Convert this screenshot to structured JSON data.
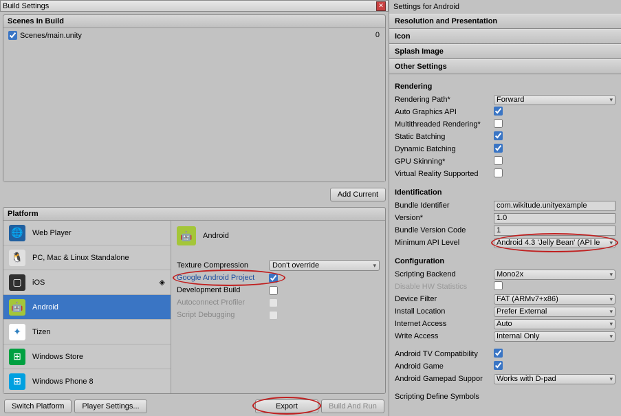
{
  "window": {
    "title": "Build Settings"
  },
  "scenes": {
    "header": "Scenes In Build",
    "items": [
      {
        "name": "Scenes/main.unity",
        "checked": true,
        "index": "0"
      }
    ],
    "add_current": "Add Current"
  },
  "platform": {
    "header": "Platform",
    "items": [
      {
        "name": "Web Player",
        "icon": "🌐",
        "bg": "#2060a0"
      },
      {
        "name": "PC, Mac & Linux Standalone",
        "icon": "🐧",
        "bg": "#e0e0e0"
      },
      {
        "name": "iOS",
        "icon": "📱",
        "bg": "#303030"
      },
      {
        "name": "Android",
        "icon": "🤖",
        "bg": "#a4c639",
        "selected": true
      },
      {
        "name": "Tizen",
        "icon": "✦",
        "bg": "#ffffff"
      },
      {
        "name": "Windows Store",
        "icon": "⊞",
        "bg": "#00a040"
      },
      {
        "name": "Windows Phone 8",
        "icon": "⊞",
        "bg": "#00a0e0"
      }
    ],
    "detail": {
      "title": "Android",
      "icon": "🤖",
      "texture_compression": {
        "label": "Texture Compression",
        "value": "Don't override"
      },
      "google_android": {
        "label": "Google Android Project",
        "checked": true
      },
      "dev_build": {
        "label": "Development Build",
        "checked": false
      },
      "autoconnect": {
        "label": "Autoconnect Profiler",
        "checked": false
      },
      "script_debug": {
        "label": "Script Debugging",
        "checked": false
      }
    }
  },
  "buttons": {
    "switch_platform": "Switch Platform",
    "player_settings": "Player Settings...",
    "export": "Export",
    "build_and_run": "Build And Run"
  },
  "right": {
    "title": "Settings for Android",
    "sections": {
      "resolution": "Resolution and Presentation",
      "icon": "Icon",
      "splash": "Splash Image",
      "other": "Other Settings"
    },
    "rendering": {
      "title": "Rendering",
      "path": {
        "label": "Rendering Path*",
        "value": "Forward"
      },
      "auto_gfx": {
        "label": "Auto Graphics API",
        "checked": true
      },
      "multithread": {
        "label": "Multithreaded Rendering*",
        "checked": false
      },
      "static_batch": {
        "label": "Static Batching",
        "checked": true
      },
      "dynamic_batch": {
        "label": "Dynamic Batching",
        "checked": true
      },
      "gpu_skin": {
        "label": "GPU Skinning*",
        "checked": false
      },
      "vr": {
        "label": "Virtual Reality Supported",
        "checked": false
      }
    },
    "identification": {
      "title": "Identification",
      "bundle": {
        "label": "Bundle Identifier",
        "value": "com.wikitude.unityexample"
      },
      "version": {
        "label": "Version*",
        "value": "1.0"
      },
      "version_code": {
        "label": "Bundle Version Code",
        "value": "1"
      },
      "min_api": {
        "label": "Minimum API Level",
        "value": "Android 4.3 'Jelly Bean' (API le"
      }
    },
    "configuration": {
      "title": "Configuration",
      "backend": {
        "label": "Scripting Backend",
        "value": "Mono2x"
      },
      "hw_stats": {
        "label": "Disable HW Statistics",
        "checked": false
      },
      "device_filter": {
        "label": "Device Filter",
        "value": "FAT (ARMv7+x86)"
      },
      "install_loc": {
        "label": "Install Location",
        "value": "Prefer External"
      },
      "internet": {
        "label": "Internet Access",
        "value": "Auto"
      },
      "write": {
        "label": "Write Access",
        "value": "Internal Only"
      },
      "tv": {
        "label": "Android TV Compatibility",
        "checked": true
      },
      "game": {
        "label": "Android Game",
        "checked": true
      },
      "gamepad": {
        "label": "Android Gamepad Suppor",
        "value": "Works with D-pad"
      },
      "symbols": {
        "label": "Scripting Define Symbols"
      }
    }
  }
}
